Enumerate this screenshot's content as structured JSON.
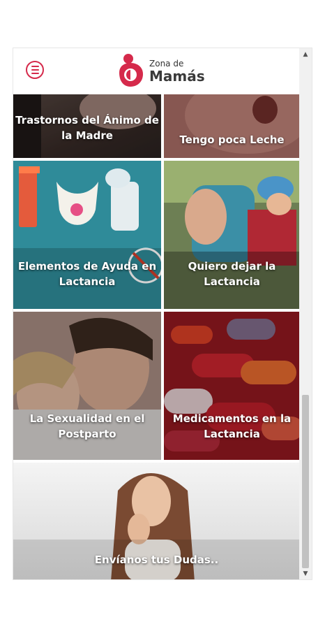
{
  "app": {
    "logo_small": "Zona de",
    "logo_big": "Mamás"
  },
  "colors": {
    "brand": "#d52a4b",
    "scrollbar_track": "#f1f1f1",
    "scrollbar_thumb": "#c1c1c1"
  },
  "icons": {
    "menu": "hamburger-menu-icon",
    "scroll_up": "triangle-up-icon",
    "scroll_down": "triangle-down-icon"
  },
  "tiles": [
    {
      "label": "Trastornos del Ánimo de la Madre"
    },
    {
      "label": "Tengo poca Leche"
    },
    {
      "label": "Elementos de Ayuda en Lactancia"
    },
    {
      "label": "Quiero dejar la Lactancia"
    },
    {
      "label": "La Sexualidad en el Postparto"
    },
    {
      "label": "Medicamentos en la Lactancia"
    },
    {
      "label": "Envíanos tus Dudas.."
    }
  ]
}
